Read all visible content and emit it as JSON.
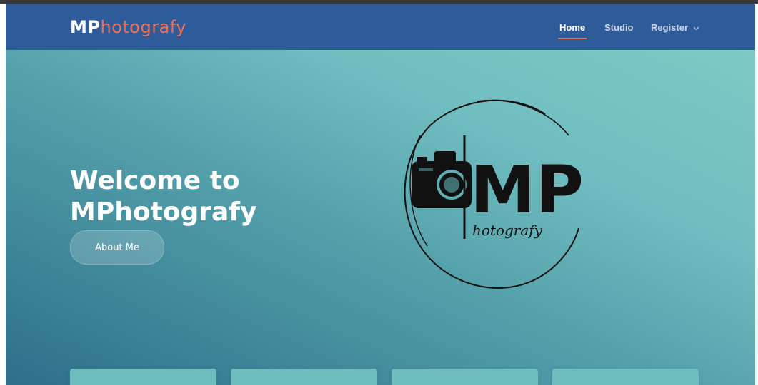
{
  "brand": {
    "part1": "MP",
    "part2": "hotografy"
  },
  "nav": {
    "home": "Home",
    "studio": "Studio",
    "register": "Register"
  },
  "hero": {
    "title_line1": "Welcome to",
    "title_line2": "MPhotografy",
    "about_button": "About Me"
  },
  "logo": {
    "monogram": "MP",
    "script": "hotografy"
  },
  "colors": {
    "navbar": "#2e5b9a",
    "accent": "#ef6e56",
    "hero_start": "#2e6f8a",
    "hero_end": "#7ccac4",
    "card": "#6dbdbe"
  },
  "icons": {
    "register_dropdown": "chevron-down-icon",
    "logo_camera": "camera-icon"
  }
}
